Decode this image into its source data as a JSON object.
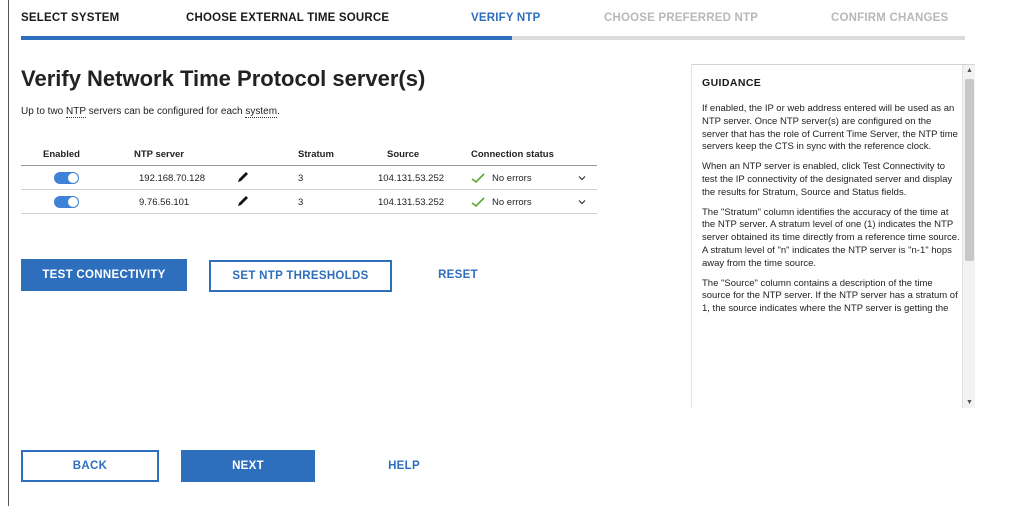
{
  "wizard": {
    "steps": [
      {
        "label": "SELECT SYSTEM",
        "state": "done"
      },
      {
        "label": "CHOOSE EXTERNAL TIME SOURCE",
        "state": "done"
      },
      {
        "label": "VERIFY NTP",
        "state": "current"
      },
      {
        "label": "CHOOSE PREFERRED NTP",
        "state": "future"
      },
      {
        "label": "CONFIRM CHANGES",
        "state": "future"
      }
    ],
    "progress_percent": 52
  },
  "main": {
    "title": "Verify Network Time Protocol server(s)",
    "subtitle_pre": "Up to two ",
    "subtitle_abbr": "NTP",
    "subtitle_mid": " servers can be configured for each ",
    "subtitle_link": "system",
    "subtitle_post": "."
  },
  "table": {
    "headers": {
      "enabled": "Enabled",
      "ntp_server": "NTP server",
      "stratum": "Stratum",
      "source": "Source",
      "status": "Connection status"
    },
    "rows": [
      {
        "enabled": true,
        "server": "192.168.70.128",
        "stratum": "3",
        "source": "104.131.53.252",
        "status": "No errors"
      },
      {
        "enabled": true,
        "server": "9.76.56.101",
        "stratum": "3",
        "source": "104.131.53.252",
        "status": "No errors"
      }
    ]
  },
  "actions": {
    "test_connectivity": "TEST CONNECTIVITY",
    "set_thresholds": "SET NTP THRESHOLDS",
    "reset": "RESET"
  },
  "footer": {
    "back": "BACK",
    "next": "NEXT",
    "help": "HELP"
  },
  "guidance": {
    "title": "GUIDANCE",
    "paragraphs": [
      "If enabled, the IP or web address entered will be used as an NTP server. Once NTP server(s) are configured on the server that has the role of Current Time Server, the NTP time servers keep the CTS in sync with the reference clock.",
      "When an NTP server is enabled, click Test Connectivity to test the IP connectivity of the designated server and display the results for Stratum, Source and Status fields.",
      "The \"Stratum\" column identifies the accuracy of the time at the NTP server. A stratum level of one (1) indicates the NTP server obtained its time directly from a reference time source. A stratum level of \"n\" indicates the NTP server is \"n-1\" hops away from the time source.",
      "The \"Source\" column contains a description of the time source for the NTP server. If the NTP server has a stratum of 1, the source indicates where the NTP server is getting the"
    ]
  },
  "colors": {
    "accent": "#2e6fbd",
    "toggle_on": "#3f82d6",
    "success": "#5aa832",
    "inactive_step": "#b8b8b8"
  },
  "icons": [
    "pencil-icon",
    "check-icon",
    "chevron-down-icon",
    "scroll-up-icon",
    "scroll-down-icon"
  ]
}
